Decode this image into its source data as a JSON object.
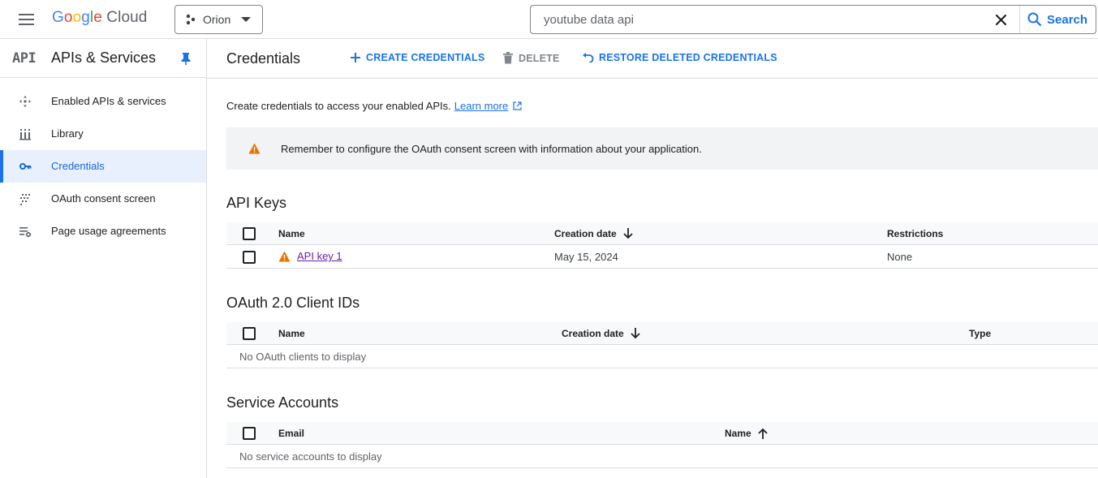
{
  "topbar": {
    "logo_google": "Google",
    "logo_cloud": "Cloud",
    "project_name": "Orion",
    "search_value": "youtube data api",
    "search_button": "Search"
  },
  "sidebar": {
    "glyph": "API",
    "title": "APIs & Services",
    "items": [
      {
        "label": "Enabled APIs & services",
        "icon": "enabled-apis-icon"
      },
      {
        "label": "Library",
        "icon": "library-icon"
      },
      {
        "label": "Credentials",
        "icon": "key-icon",
        "active": true
      },
      {
        "label": "OAuth consent screen",
        "icon": "oauth-consent-icon"
      },
      {
        "label": "Page usage agreements",
        "icon": "settings-list-icon"
      }
    ]
  },
  "main": {
    "title": "Credentials",
    "actions": {
      "create": "CREATE CREDENTIALS",
      "delete": "DELETE",
      "restore": "RESTORE DELETED CREDENTIALS"
    },
    "intro_text": "Create credentials to access your enabled APIs.",
    "learn_more": "Learn more",
    "banner_text": "Remember to configure the OAuth consent screen with information about your application.",
    "api_keys": {
      "title": "API Keys",
      "headers": {
        "name": "Name",
        "creation_date": "Creation date",
        "restrictions": "Restrictions"
      },
      "rows": [
        {
          "name": "API key 1",
          "creation_date": "May 15, 2024",
          "restrictions": "None"
        }
      ]
    },
    "oauth": {
      "title": "OAuth 2.0 Client IDs",
      "headers": {
        "name": "Name",
        "creation_date": "Creation date",
        "type": "Type"
      },
      "empty": "No OAuth clients to display"
    },
    "service_accounts": {
      "title": "Service Accounts",
      "headers": {
        "email": "Email",
        "name": "Name"
      },
      "empty": "No service accounts to display"
    }
  },
  "colors": {
    "accent": "#1a73e8",
    "warning": "#e37400",
    "visited_link": "#681da8",
    "active_bg": "#e8f0fe"
  }
}
